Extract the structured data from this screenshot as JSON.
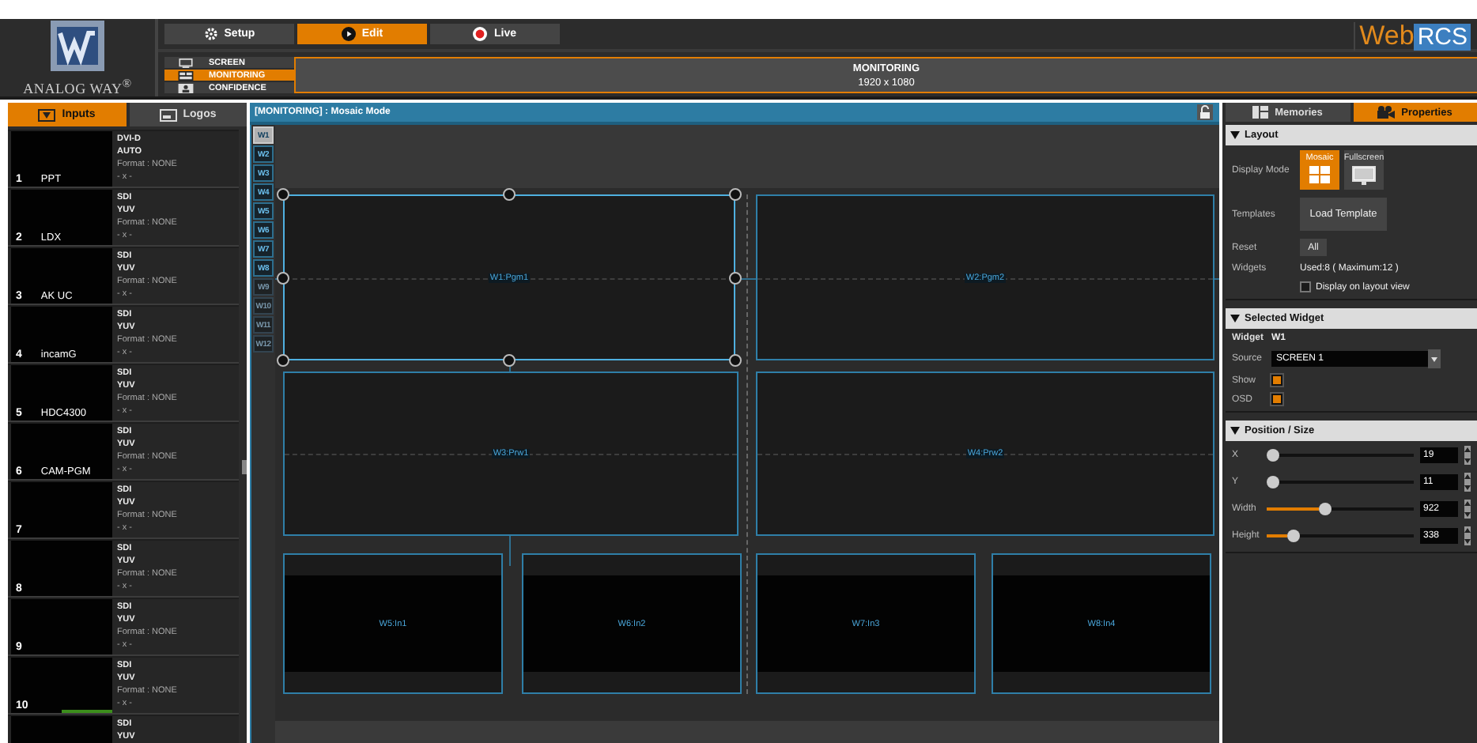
{
  "logo": {
    "text": "ANALOG WAY$^{®}$"
  },
  "brand": {
    "part_1": "Web",
    "part_2": "RCS"
  },
  "modes": [
    {
      "label": "Setup",
      "kind": "gear",
      "selected": false
    },
    {
      "label": "Edit",
      "kind": "play",
      "selected": true
    },
    {
      "label": "Live",
      "kind": "record",
      "selected": false
    }
  ],
  "screens": [
    {
      "label": "SCREEN",
      "kind": "monitor",
      "selected": false
    },
    {
      "label": "MONITORING",
      "kind": "multiview",
      "selected": true
    },
    {
      "label": "CONFIDENCE",
      "kind": "person",
      "selected": false
    }
  ],
  "screen_banner": {
    "title": "MONITORING",
    "resolution": "1920 x 1080"
  },
  "source_tabs": [
    {
      "label": "Inputs",
      "kind": "input",
      "selected": true
    },
    {
      "label": "Logos",
      "kind": "logo",
      "selected": false
    }
  ],
  "inputs": [
    {
      "number": "1",
      "name": "PPT",
      "lines": [
        "DVI-D",
        "AUTO",
        "Format : NONE",
        "- x -"
      ]
    },
    {
      "number": "2",
      "name": "LDX",
      "lines": [
        "SDI",
        "YUV",
        "Format : NONE",
        "- x -"
      ]
    },
    {
      "number": "3",
      "name": "AK UC",
      "lines": [
        "SDI",
        "YUV",
        "Format : NONE",
        "- x -"
      ]
    },
    {
      "number": "4",
      "name": "incamG",
      "lines": [
        "SDI",
        "YUV",
        "Format : NONE",
        "- x -"
      ]
    },
    {
      "number": "5",
      "name": "HDC4300",
      "lines": [
        "SDI",
        "YUV",
        "Format : NONE",
        "- x -"
      ]
    },
    {
      "number": "6",
      "name": "CAM-PGM",
      "lines": [
        "SDI",
        "YUV",
        "Format : NONE",
        "- x -"
      ]
    },
    {
      "number": "7",
      "lines": [
        "SDI",
        "YUV",
        "Format : NONE",
        "- x -"
      ]
    },
    {
      "number": "8",
      "lines": [
        "SDI",
        "YUV",
        "Format : NONE",
        "- x -"
      ]
    },
    {
      "number": "9",
      "lines": [
        "SDI",
        "YUV",
        "Format : NONE",
        "- x -"
      ]
    },
    {
      "number": "10",
      "lines": [
        "SDI",
        "YUV",
        "Format : NONE",
        "- x -"
      ],
      "level": 0.5
    },
    {
      "lines": [
        "SDI",
        "YUV"
      ]
    }
  ],
  "canvas": {
    "title": "[MONITORING] : Mosaic Mode"
  },
  "widget_buttons": [
    {
      "label": "W1",
      "selected": true,
      "enabled": true
    },
    {
      "label": "W2",
      "selected": false,
      "enabled": true
    },
    {
      "label": "W3",
      "selected": false,
      "enabled": true
    },
    {
      "label": "W4",
      "selected": false,
      "enabled": true
    },
    {
      "label": "W5",
      "selected": false,
      "enabled": true
    },
    {
      "label": "W6",
      "selected": false,
      "enabled": true
    },
    {
      "label": "W7",
      "selected": false,
      "enabled": true
    },
    {
      "label": "W8",
      "selected": false,
      "enabled": true
    },
    {
      "label": "W9",
      "selected": false,
      "enabled": false
    },
    {
      "label": "W10",
      "selected": false,
      "enabled": false
    },
    {
      "label": "W11",
      "selected": false,
      "enabled": false
    },
    {
      "label": "W12",
      "selected": false,
      "enabled": false
    }
  ],
  "widgets": [
    {
      "label": "W1:Pgm1",
      "kind": "large",
      "selected": true
    },
    {
      "label": "W2:Pgm2",
      "kind": "large",
      "selected": false
    },
    {
      "label": "W3:Prw1",
      "kind": "large",
      "selected": false
    },
    {
      "label": "W4:Prw2",
      "kind": "large",
      "selected": false
    },
    {
      "label": "W5:In1",
      "kind": "small",
      "selected": false
    },
    {
      "label": "W6:In2",
      "kind": "small",
      "selected": false
    },
    {
      "label": "W7:In3",
      "kind": "small",
      "selected": false
    },
    {
      "label": "W8:In4",
      "kind": "small",
      "selected": false
    }
  ],
  "properties": {
    "tabs": [
      {
        "label": "Memories",
        "kind": "memories",
        "selected": false
      },
      {
        "label": "Properties",
        "kind": "properties",
        "selected": true
      }
    ],
    "layout": {
      "title": "Layout",
      "expanded": true,
      "display_mode_label": "Display Mode",
      "display_modes": [
        {
          "label": "Mosaic",
          "kind": "mosaic",
          "selected": true
        },
        {
          "label": "Fullscreen",
          "kind": "fullscreen",
          "selected": false
        }
      ],
      "templates_label": "Templates",
      "load_button": "Load Template",
      "reset_label": "Reset",
      "reset_button": "All",
      "widgets_label": "Widgets",
      "widgets_value": "Used:8 ( Maximum:12 )",
      "display_on_layout": {
        "label": "Display on layout view",
        "checked": false
      }
    },
    "selected_widget": {
      "title": "Selected Widget",
      "expanded": true,
      "widget_label": "Widget",
      "widget_value": "W1",
      "source_label": "Source",
      "source_value": "SCREEN 1",
      "show": {
        "label": "Show",
        "checked": true
      },
      "osd": {
        "label": "OSD",
        "checked": true
      }
    },
    "position": {
      "title": "Position / Size",
      "expanded": true,
      "fields": [
        {
          "label": "X",
          "level": 0.03,
          "value": "19"
        },
        {
          "label": "Y",
          "level": 0.03,
          "value": "11"
        },
        {
          "label": "Width",
          "level": 0.4,
          "value": "922"
        },
        {
          "label": "Height",
          "level": 0.18,
          "value": "338"
        }
      ]
    }
  }
}
